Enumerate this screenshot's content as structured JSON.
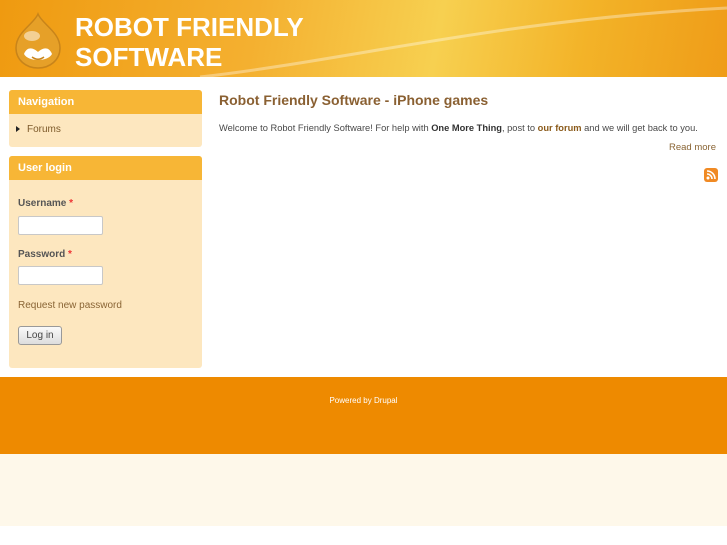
{
  "header": {
    "site_name_line1": "ROBOT FRIENDLY",
    "site_name_line2": "SOFTWARE"
  },
  "navigation": {
    "title": "Navigation",
    "items": [
      {
        "label": "Forums"
      }
    ]
  },
  "user_login": {
    "title": "User login",
    "username_label": "Username",
    "password_label": "Password",
    "required_mark": "*",
    "username_value": "",
    "password_value": "",
    "request_password": "Request new password",
    "login_button": "Log in"
  },
  "main": {
    "title": "Robot Friendly Software - iPhone games",
    "intro_1": "Welcome to Robot Friendly Software! For help with ",
    "intro_bold": "One More Thing",
    "intro_2": ", post to ",
    "intro_link": "our forum",
    "intro_3": " and we will get back to you.",
    "read_more": "Read more"
  },
  "footer": {
    "text": "Powered by Drupal"
  }
}
